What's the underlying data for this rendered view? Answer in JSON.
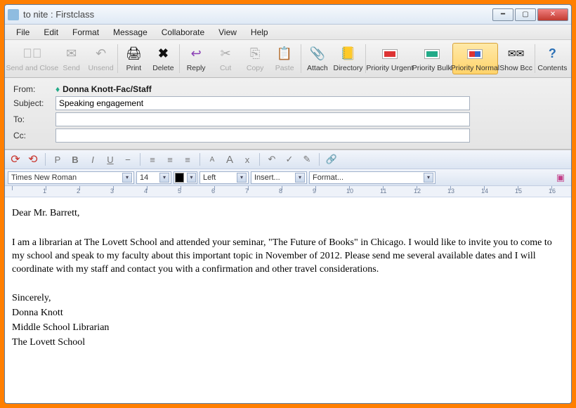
{
  "window": {
    "title": "to nite : Firstclass"
  },
  "menu": [
    "File",
    "Edit",
    "Format",
    "Message",
    "Collaborate",
    "View",
    "Help"
  ],
  "toolbar": {
    "send_close": "Send and Close",
    "send": "Send",
    "unsend": "Unsend",
    "print": "Print",
    "delete": "Delete",
    "reply": "Reply",
    "cut": "Cut",
    "copy": "Copy",
    "paste": "Paste",
    "attach": "Attach",
    "directory": "Directory",
    "priority_urgent": "Priority Urgent",
    "priority_bulk": "Priority Bulk",
    "priority_normal": "Priority Normal",
    "show_bcc": "Show Bcc",
    "contents": "Contents"
  },
  "headers": {
    "from_label": "From:",
    "from_value": "Donna Knott-Fac/Staff",
    "subject_label": "Subject:",
    "subject_value": "Speaking engagement",
    "to_label": "To:",
    "to_value": "",
    "cc_label": "Cc:",
    "cc_value": ""
  },
  "format": {
    "font": "Times New Roman",
    "size": "14",
    "align": "Left",
    "insert": "Insert...",
    "format": "Format..."
  },
  "body": {
    "greeting": "Dear Mr. Barrett,",
    "para": "I am a librarian at The Lovett School and attended your seminar, \"The Future of Books\" in Chicago.  I would like to invite you to come to my school and speak to my faculty about this important topic in November of 2012.  Please send me several available dates and I will coordinate with my staff and contact you with a confirmation and other travel considerations.",
    "sig1": "Sincerely,",
    "sig2": "Donna Knott",
    "sig3": "Middle School Librarian",
    "sig4": "The Lovett School"
  }
}
